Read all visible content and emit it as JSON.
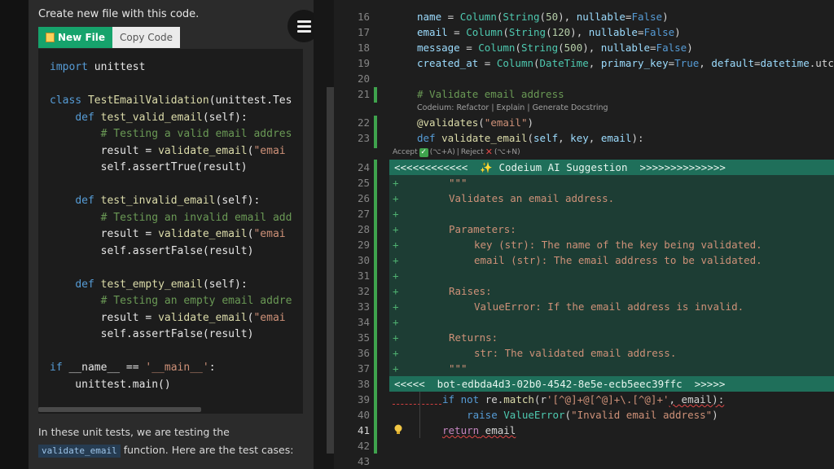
{
  "chat": {
    "header": "Create new file with this code.",
    "new_file_label": "New File",
    "copy_code_label": "Copy Code",
    "code_lines": [
      [
        [
          "k",
          "import"
        ],
        [
          "p",
          " unittest"
        ]
      ],
      [],
      [
        [
          "k",
          "class"
        ],
        [
          "p",
          " "
        ],
        [
          "f",
          "TestEmailValidation"
        ],
        [
          "p",
          "(unittest.Tes"
        ]
      ],
      [
        [
          "p",
          "    "
        ],
        [
          "k",
          "def"
        ],
        [
          "p",
          " "
        ],
        [
          "f",
          "test_valid_email"
        ],
        [
          "p",
          "(self):"
        ]
      ],
      [
        [
          "p",
          "        "
        ],
        [
          "c",
          "# Testing a valid email addres"
        ]
      ],
      [
        [
          "p",
          "        result = "
        ],
        [
          "f",
          "validate_email"
        ],
        [
          "p",
          "("
        ],
        [
          "s",
          "\"emai"
        ]
      ],
      [
        [
          "p",
          "        self.assertTrue(result)"
        ]
      ],
      [],
      [
        [
          "p",
          "    "
        ],
        [
          "k",
          "def"
        ],
        [
          "p",
          " "
        ],
        [
          "f",
          "test_invalid_email"
        ],
        [
          "p",
          "(self):"
        ]
      ],
      [
        [
          "p",
          "        "
        ],
        [
          "c",
          "# Testing an invalid email add"
        ]
      ],
      [
        [
          "p",
          "        result = "
        ],
        [
          "f",
          "validate_email"
        ],
        [
          "p",
          "("
        ],
        [
          "s",
          "\"emai"
        ]
      ],
      [
        [
          "p",
          "        self.assertFalse(result)"
        ]
      ],
      [],
      [
        [
          "p",
          "    "
        ],
        [
          "k",
          "def"
        ],
        [
          "p",
          " "
        ],
        [
          "f",
          "test_empty_email"
        ],
        [
          "p",
          "(self):"
        ]
      ],
      [
        [
          "p",
          "        "
        ],
        [
          "c",
          "# Testing an empty email addre"
        ]
      ],
      [
        [
          "p",
          "        result = "
        ],
        [
          "f",
          "validate_email"
        ],
        [
          "p",
          "("
        ],
        [
          "s",
          "\"emai"
        ]
      ],
      [
        [
          "p",
          "        self.assertFalse(result)"
        ]
      ],
      [],
      [
        [
          "k",
          "if"
        ],
        [
          "p",
          " __name__ == "
        ],
        [
          "s",
          "'__main__'"
        ],
        [
          "p",
          ":"
        ]
      ],
      [
        [
          "p",
          "    unittest.main()"
        ]
      ]
    ],
    "note_line1": "In these unit tests, we are testing the",
    "note_chip": "validate_email",
    "note_line2_rest": " function. Here are the test cases:"
  },
  "editor": {
    "lines": [
      {
        "n": "16",
        "tokens": [
          [
            "v",
            "name"
          ],
          [
            "p",
            " = "
          ],
          [
            "t",
            "Column"
          ],
          [
            "p",
            "("
          ],
          [
            "t",
            "String"
          ],
          [
            "p",
            "("
          ],
          [
            "n",
            "50"
          ],
          [
            "p",
            "), "
          ],
          [
            "v",
            "nullable"
          ],
          [
            "p",
            "="
          ],
          [
            "k",
            "False"
          ],
          [
            "p",
            ")"
          ]
        ]
      },
      {
        "n": "17",
        "tokens": [
          [
            "v",
            "email"
          ],
          [
            "p",
            " = "
          ],
          [
            "t",
            "Column"
          ],
          [
            "p",
            "("
          ],
          [
            "t",
            "String"
          ],
          [
            "p",
            "("
          ],
          [
            "n",
            "120"
          ],
          [
            "p",
            "), "
          ],
          [
            "v",
            "nullable"
          ],
          [
            "p",
            "="
          ],
          [
            "k",
            "False"
          ],
          [
            "p",
            ")"
          ]
        ]
      },
      {
        "n": "18",
        "tokens": [
          [
            "v",
            "message"
          ],
          [
            "p",
            " = "
          ],
          [
            "t",
            "Column"
          ],
          [
            "p",
            "("
          ],
          [
            "t",
            "String"
          ],
          [
            "p",
            "("
          ],
          [
            "n",
            "500"
          ],
          [
            "p",
            "), "
          ],
          [
            "v",
            "nullable"
          ],
          [
            "p",
            "="
          ],
          [
            "k",
            "False"
          ],
          [
            "p",
            ")"
          ]
        ]
      },
      {
        "n": "19",
        "tokens": [
          [
            "v",
            "created_at"
          ],
          [
            "p",
            " = "
          ],
          [
            "t",
            "Column"
          ],
          [
            "p",
            "("
          ],
          [
            "t",
            "DateTime"
          ],
          [
            "p",
            ", "
          ],
          [
            "v",
            "primary_key"
          ],
          [
            "p",
            "="
          ],
          [
            "k",
            "True"
          ],
          [
            "p",
            ", "
          ],
          [
            "v",
            "default"
          ],
          [
            "p",
            "="
          ],
          [
            "v",
            "datetime"
          ],
          [
            "p",
            ".utc"
          ]
        ]
      },
      {
        "n": "20",
        "tokens": []
      },
      {
        "n": "21",
        "tokens": [
          [
            "c",
            "# Validate email address"
          ]
        ]
      },
      {
        "n": "22",
        "tokens": [
          [
            "f",
            "@validates"
          ],
          [
            "p",
            "("
          ],
          [
            "s",
            "\"email\""
          ],
          [
            "p",
            ")"
          ]
        ]
      },
      {
        "n": "23",
        "tokens": [
          [
            "k",
            "def"
          ],
          [
            "p",
            " "
          ],
          [
            "f",
            "validate_email"
          ],
          [
            "p",
            "("
          ],
          [
            "v",
            "self"
          ],
          [
            "p",
            ", "
          ],
          [
            "v",
            "key"
          ],
          [
            "p",
            ", "
          ],
          [
            "v",
            "email"
          ],
          [
            "p",
            "):"
          ]
        ]
      }
    ],
    "lens_text": "Codeium: Refactor | Explain | Generate Docstring",
    "accept_label": "Accept",
    "accept_shortcut": "(⌥+A)",
    "reject_label": "Reject",
    "reject_shortcut": "(⌥+N)",
    "sep": "|",
    "suggestion_header": "<<<<<<<<<<<<  ✨ Codeium AI Suggestion  >>>>>>>>>>>>>>",
    "doc_lines": [
      {
        "n": "24",
        "text": "",
        "header": true
      },
      {
        "n": "25",
        "text": "\"\"\"",
        "indent": 1
      },
      {
        "n": "26",
        "text": "Validates an email address.",
        "indent": 1
      },
      {
        "n": "27",
        "text": "",
        "indent": 1
      },
      {
        "n": "28",
        "text": "Parameters:",
        "indent": 1
      },
      {
        "n": "29",
        "text": "key (str): The name of the key being validated.",
        "indent": 2
      },
      {
        "n": "30",
        "text": "email (str): The email address to be validated.",
        "indent": 2
      },
      {
        "n": "31",
        "text": "",
        "indent": 1
      },
      {
        "n": "32",
        "text": "Raises:",
        "indent": 1
      },
      {
        "n": "33",
        "text": "ValueError: If the email address is invalid.",
        "indent": 2
      },
      {
        "n": "34",
        "text": "",
        "indent": 1
      },
      {
        "n": "35",
        "text": "Returns:",
        "indent": 1
      },
      {
        "n": "36",
        "text": "str: The validated email address.",
        "indent": 2
      },
      {
        "n": "37",
        "text": "\"\"\"",
        "indent": 1
      }
    ],
    "footer_num": "38",
    "suggestion_footer": "<<<<<  bot-edbda4d3-02b0-4542-8e5e-ecb5eec39ffc  >>>>>",
    "tail_lines": [
      {
        "n": "39",
        "tokens": [
          [
            "k",
            "if"
          ],
          [
            "p",
            " "
          ],
          [
            "k",
            "not"
          ],
          [
            "p",
            " re."
          ],
          [
            "f",
            "match"
          ],
          [
            "p",
            "(r"
          ],
          [
            "s",
            "'[^@]+@[^@]+\\.[^@]+'"
          ],
          [
            "p",
            ", email):"
          ]
        ]
      },
      {
        "n": "40",
        "tokens": [
          [
            "p",
            "    "
          ],
          [
            "k",
            "raise"
          ],
          [
            "p",
            " "
          ],
          [
            "t",
            "ValueError"
          ],
          [
            "p",
            "("
          ],
          [
            "s",
            "\"Invalid email address\""
          ],
          [
            "p",
            ")"
          ]
        ]
      },
      {
        "n": "41",
        "tokens": [
          [
            "p",
            "return"
          ],
          [
            "p",
            " email"
          ]
        ]
      },
      {
        "n": "42",
        "tokens": []
      },
      {
        "n": "43",
        "tokens": []
      }
    ]
  }
}
